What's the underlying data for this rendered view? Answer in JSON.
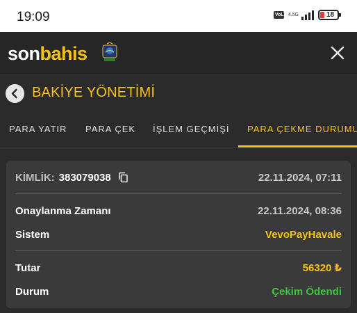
{
  "status_bar": {
    "time": "19:09",
    "network": "4.5G",
    "volte": "VoLTE",
    "battery": "18"
  },
  "header": {
    "logo_son": "son",
    "logo_bahis": "bahis",
    "close_icon": "close-icon"
  },
  "page": {
    "title": "BAKİYE YÖNETİMİ"
  },
  "tabs": [
    {
      "label": "PARA YATIR",
      "active": false
    },
    {
      "label": "PARA ÇEK",
      "active": false
    },
    {
      "label": "İŞLEM GEÇMİŞİ",
      "active": false
    },
    {
      "label": "PARA ÇEKME DURUMU",
      "active": true
    }
  ],
  "transaction": {
    "id_label": "KİMLİK:",
    "id_value": "383079038",
    "created_at": "22.11.2024, 07:11",
    "approval_label": "Onaylanma Zamanı",
    "approval_value": "22.11.2024, 08:36",
    "system_label": "Sistem",
    "system_value": "VevoPayHavale",
    "amount_label": "Tutar",
    "amount_value": "56320 ₺",
    "status_label": "Durum",
    "status_value": "Çekim Ödendi"
  },
  "colors": {
    "accent": "#f5c21b",
    "success": "#3fc341",
    "background": "#2b2b2b",
    "card": "#3a3a3a"
  }
}
